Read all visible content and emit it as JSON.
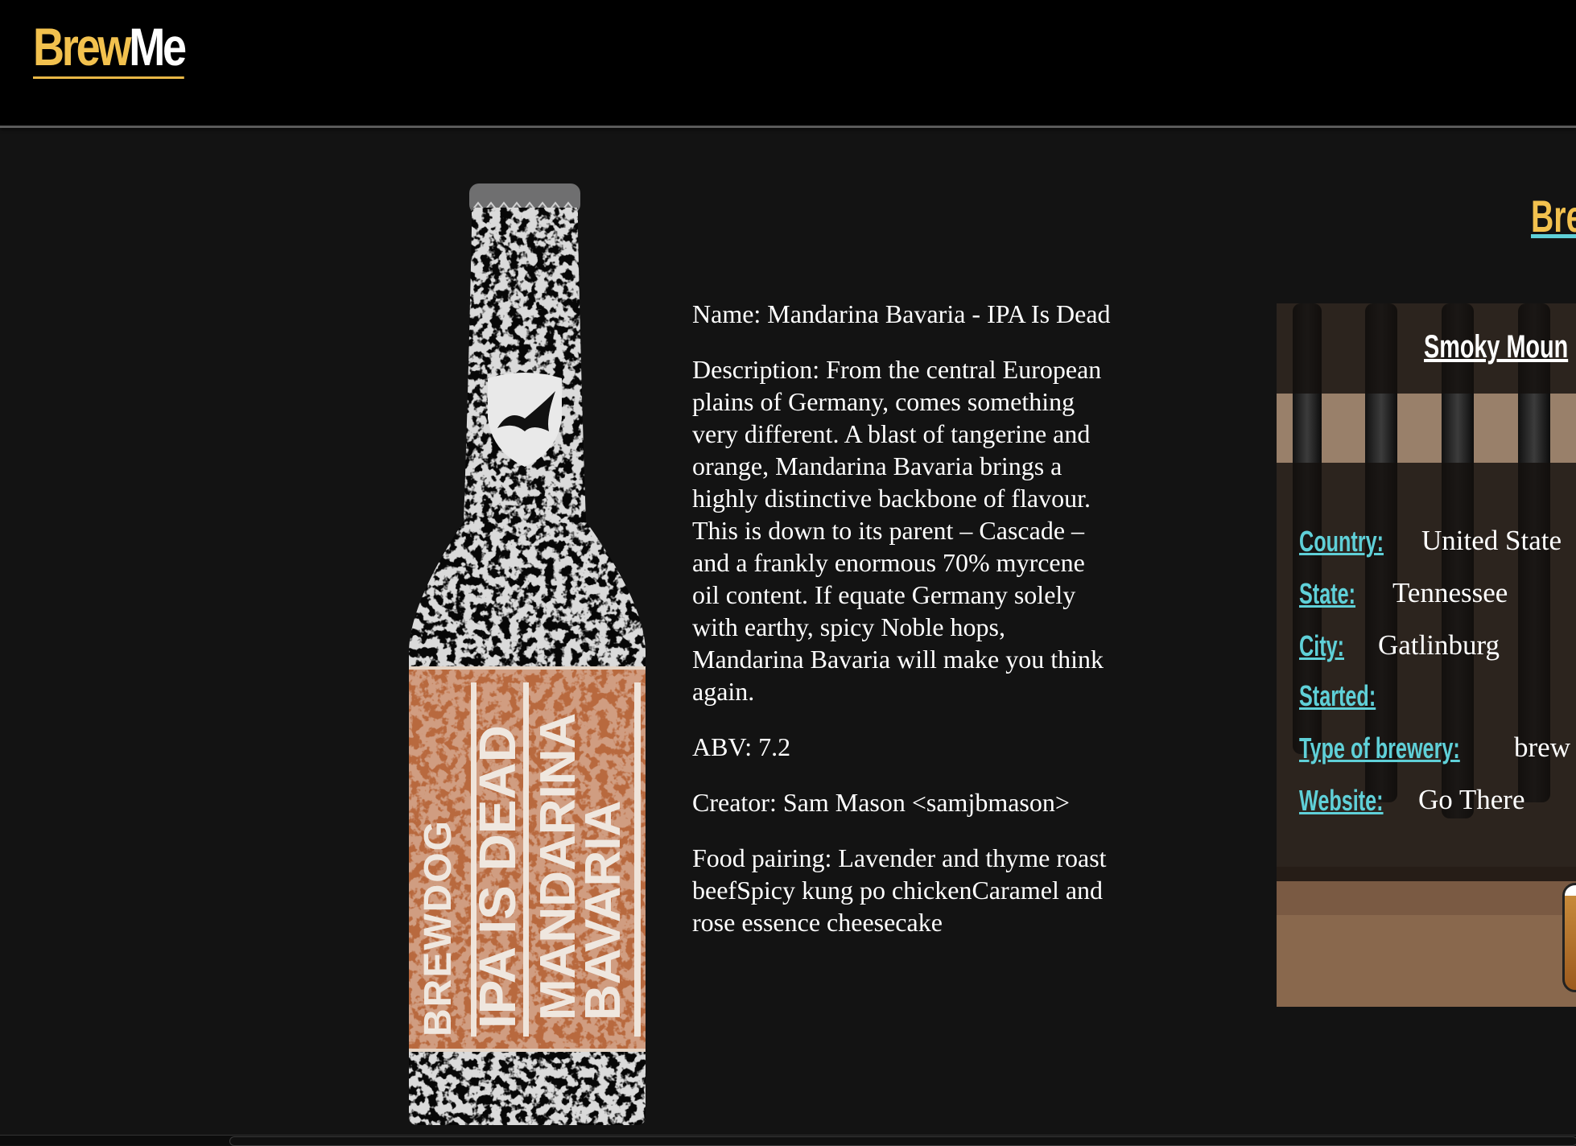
{
  "brand": {
    "brew": "Brew",
    "me": "Me"
  },
  "beer": {
    "image_alt": "IPA Is Dead Mandarina Bavaria bottle",
    "label_brand": "BREWDOG",
    "label_line1": "IPA IS DEAD",
    "label_line2": "MANDARINA",
    "label_line3": "BAVARIA",
    "name": "Name: Mandarina Bavaria - IPA Is Dead",
    "description": "Description: From the central European plains of Germany, comes something very different. A blast of tangerine and orange, Mandarina Bavaria brings a highly distinctive backbone of flavour. This is down to its parent – Cascade – and a frankly enormous 70% myrcene oil content. If equate Germany solely with earthy, spicy Noble hops, Mandarina Bavaria will make you think again.",
    "abv": "ABV: 7.2",
    "creator": "Creator: Sam Mason <samjbmason>",
    "food_pairing": "Food pairing: Lavender and thyme roast beefSpicy kung po chickenCaramel and rose essence cheesecake"
  },
  "brewery_section": {
    "title_visible": "Bre"
  },
  "brewery": {
    "name_visible": "Smoky Moun",
    "country_label": "Country:",
    "country_value": "United State",
    "state_label": "State:",
    "state_value": "Tennessee",
    "city_label": "City:",
    "city_value": "Gatlinburg",
    "started_label": "Started:",
    "started_value": "",
    "type_label": "Type of brewery:",
    "type_value": "brew",
    "website_label": "Website:",
    "website_value": "Go There"
  },
  "colors": {
    "accent_yellow": "#f2c14e",
    "accent_teal": "#5fd0d8",
    "label_orange": "#b8693e"
  }
}
